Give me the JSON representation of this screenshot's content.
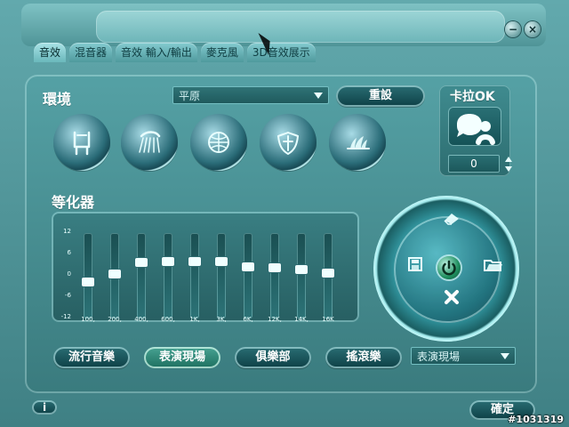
{
  "tabs": [
    "音效",
    "混音器",
    "音效 輸入/輸出",
    "麥克風",
    "3D音效展示"
  ],
  "active_tab_index": 0,
  "environment": {
    "label": "環境",
    "select_value": "平原",
    "reset_button": "重設",
    "preset_icons": [
      "chair-icon",
      "shower-icon",
      "globe-icon",
      "shield-icon",
      "opera-house-icon"
    ]
  },
  "karaoke": {
    "label": "卡拉OK",
    "value": "0"
  },
  "equalizer": {
    "label": "等化器",
    "db_labels": [
      "12",
      "6",
      "0",
      "-6",
      "-12"
    ],
    "bands": [
      {
        "label": "100,",
        "level": 0.42
      },
      {
        "label": "200,",
        "level": 0.52
      },
      {
        "label": "400,",
        "level": 0.67
      },
      {
        "label": "600,",
        "level": 0.69
      },
      {
        "label": "1K,",
        "level": 0.69
      },
      {
        "label": "3K,",
        "level": 0.69
      },
      {
        "label": "6K,",
        "level": 0.62
      },
      {
        "label": "12K,",
        "level": 0.6
      },
      {
        "label": "14K,",
        "level": 0.58
      },
      {
        "label": "16K",
        "level": 0.54
      }
    ],
    "presets": [
      "流行音樂",
      "表演現場",
      "俱樂部",
      "搖滾樂"
    ],
    "active_preset_index": 1,
    "preset_select_value": "表演現場"
  },
  "footer": {
    "info_button": "i",
    "ok_button": "確定",
    "watermark": "#1031319"
  },
  "icons": {
    "wheel": [
      "eraser-icon",
      "save-icon",
      "power-icon",
      "folder-open-icon",
      "close-icon"
    ]
  }
}
